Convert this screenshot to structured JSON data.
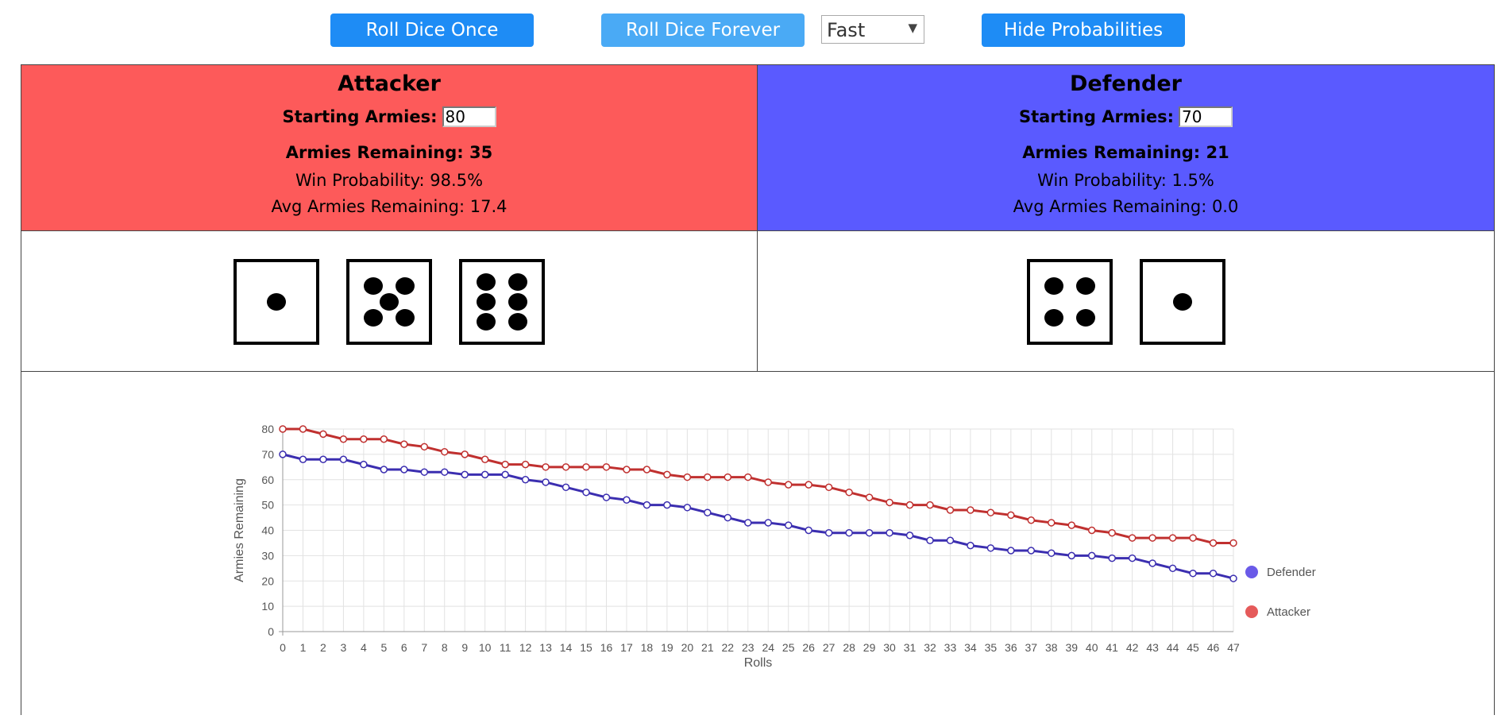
{
  "toolbar": {
    "roll_once": "Roll Dice Once",
    "roll_forever": "Roll Dice Forever",
    "speed_value": "Fast",
    "toggle_probabilities": "Hide Probabilities"
  },
  "attacker": {
    "title": "Attacker",
    "starting_label": "Starting Armies:",
    "starting_value": "80",
    "remaining": "Armies Remaining: 35",
    "win_probability": "Win Probability: 98.5%",
    "avg_remaining": "Avg Armies Remaining: 17.4",
    "color": "#fd5a5a",
    "dice": [
      1,
      5,
      6
    ]
  },
  "defender": {
    "title": "Defender",
    "starting_label": "Starting Armies:",
    "starting_value": "70",
    "remaining": "Armies Remaining: 21",
    "win_probability": "Win Probability: 1.5%",
    "avg_remaining": "Avg Armies Remaining: 0.0",
    "color": "#5a5aff",
    "dice": [
      4,
      1
    ]
  },
  "chart_data": {
    "type": "line",
    "xlabel": "Rolls",
    "ylabel": "Armies Remaining",
    "ylim": [
      0,
      80
    ],
    "yticks": [
      0,
      10,
      20,
      30,
      40,
      50,
      60,
      70,
      80
    ],
    "x": [
      0,
      1,
      2,
      3,
      4,
      5,
      6,
      7,
      8,
      9,
      10,
      11,
      12,
      13,
      14,
      15,
      16,
      17,
      18,
      19,
      20,
      21,
      22,
      23,
      24,
      25,
      26,
      27,
      28,
      29,
      30,
      31,
      32,
      33,
      34,
      35,
      36,
      37,
      38,
      39,
      40,
      41,
      42,
      43,
      44,
      45,
      46,
      47
    ],
    "grid": true,
    "legend_position": "right",
    "series": [
      {
        "name": "Defender",
        "color": "#3b2eb0",
        "legend_color": "#6a5ae8",
        "values": [
          70,
          68,
          68,
          68,
          66,
          64,
          64,
          63,
          63,
          62,
          62,
          62,
          60,
          59,
          57,
          55,
          53,
          52,
          50,
          50,
          49,
          47,
          45,
          43,
          43,
          42,
          40,
          39,
          39,
          39,
          39,
          38,
          36,
          36,
          34,
          33,
          32,
          32,
          31,
          30,
          30,
          29,
          29,
          27,
          25,
          23,
          23,
          21
        ]
      },
      {
        "name": "Attacker",
        "color": "#c0302f",
        "legend_color": "#e55a5a",
        "values": [
          80,
          80,
          78,
          76,
          76,
          76,
          74,
          73,
          71,
          70,
          68,
          66,
          66,
          65,
          65,
          65,
          65,
          64,
          64,
          62,
          61,
          61,
          61,
          61,
          59,
          58,
          58,
          57,
          55,
          53,
          51,
          50,
          50,
          48,
          48,
          47,
          46,
          44,
          43,
          42,
          40,
          39,
          37,
          37,
          37,
          37,
          35,
          35
        ]
      }
    ]
  }
}
